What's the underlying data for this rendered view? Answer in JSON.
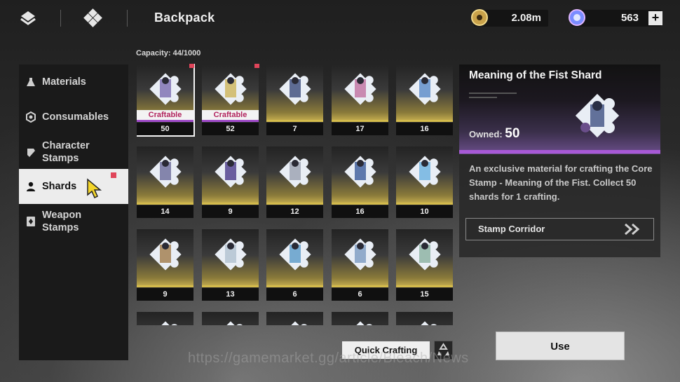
{
  "header": {
    "title": "Backpack",
    "currencies": [
      {
        "name": "gold-coin",
        "value": "2.08m"
      },
      {
        "name": "spirit-orb",
        "value": "563"
      }
    ],
    "plus_label": "+"
  },
  "sidebar": {
    "items": [
      {
        "label": "Materials",
        "icon": "flask-icon"
      },
      {
        "label": "Consumables",
        "icon": "hexagon-icon"
      },
      {
        "label": "Character Stamps",
        "icon": "stamp-icon"
      },
      {
        "label": "Shards",
        "icon": "person-icon",
        "active": true
      },
      {
        "label": "Weapon Stamps",
        "icon": "card-icon"
      }
    ]
  },
  "inventory": {
    "capacity": "Capacity: 44/1000",
    "craftable_label": "Craftable",
    "items": [
      {
        "count": "50",
        "craftable": true,
        "selected": true,
        "new": true
      },
      {
        "count": "52",
        "craftable": true,
        "new": true
      },
      {
        "count": "7"
      },
      {
        "count": "17"
      },
      {
        "count": "16"
      },
      {
        "count": "14"
      },
      {
        "count": "9"
      },
      {
        "count": "12"
      },
      {
        "count": "16"
      },
      {
        "count": "10"
      },
      {
        "count": "9"
      },
      {
        "count": "13"
      },
      {
        "count": "6"
      },
      {
        "count": "6"
      },
      {
        "count": "15"
      }
    ]
  },
  "detail": {
    "title": "Meaning of the Fist Shard",
    "owned_label": "Owned:",
    "owned_value": "50",
    "description": "An exclusive material for crafting the Core Stamp - Meaning of the Fist. Collect 50 shards for 1 crafting.",
    "source_label": "Stamp Corridor"
  },
  "actions": {
    "quick_crafting": "Quick Crafting",
    "use": "Use"
  },
  "watermark": "https://gamemarket.gg/article/Bleach/News",
  "colors": {
    "accent_purple": "#a859d6",
    "craftable_text": "#b2245e",
    "badge_red": "#e0455a",
    "gold": "#d4bb4c"
  }
}
